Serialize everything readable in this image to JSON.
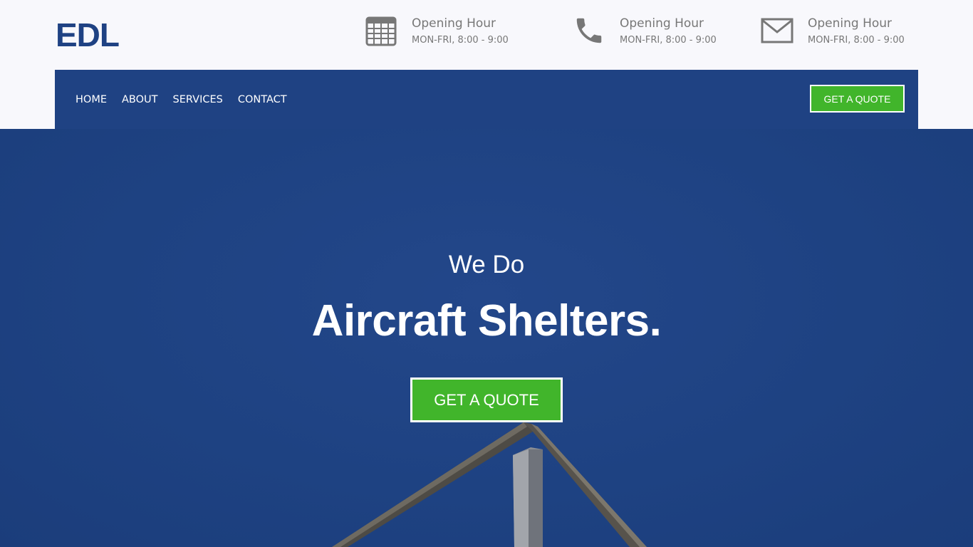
{
  "brand": {
    "logo_text": "EDL",
    "color": "#1f4283"
  },
  "contact_info": [
    {
      "icon": "calendar-icon",
      "title": "Opening Hour",
      "subtitle": "MON-FRI, 8:00 - 9:00"
    },
    {
      "icon": "phone-icon",
      "title": "Opening Hour",
      "subtitle": "MON-FRI, 8:00 - 9:00"
    },
    {
      "icon": "mail-icon",
      "title": "Opening Hour",
      "subtitle": "MON-FRI, 8:00 - 9:00"
    }
  ],
  "nav": {
    "items": [
      {
        "label": "HOME"
      },
      {
        "label": "ABOUT"
      },
      {
        "label": "SERVICES"
      },
      {
        "label": "CONTACT"
      }
    ],
    "quote_button": "GET A QUOTE"
  },
  "hero": {
    "kicker": "We Do",
    "headline": "Aircraft Shelters.",
    "cta": "GET A QUOTE"
  },
  "colors": {
    "primary": "#1f4283",
    "accent": "#41b52b",
    "muted_text": "#777777"
  }
}
